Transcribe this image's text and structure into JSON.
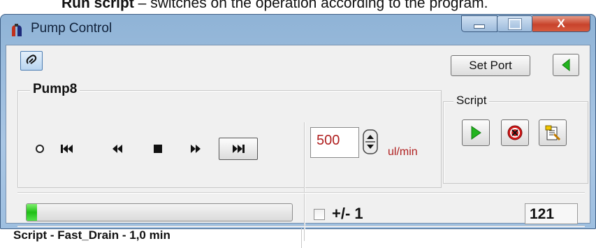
{
  "doc_text": {
    "bold": "Run script",
    "rest": " – switches on the operation according to the program."
  },
  "window": {
    "title": "Pump Control",
    "close_glyph": "X"
  },
  "toolbar": {
    "set_port_label": "Set Port"
  },
  "pump": {
    "name": "Pump8",
    "rate_value": "500",
    "rate_unit": "ul/min"
  },
  "script_group": {
    "label": "Script"
  },
  "status": {
    "progress_fraction": 0.04,
    "tolerance_label": "+/- 1",
    "tolerance_checked": false,
    "count_value": "121",
    "script_status": "Script - Fast_Drain  - 1,0 min"
  },
  "colors": {
    "rate_text": "#b02020",
    "progress_fill": "#1fbf16",
    "play_green": "#22b41e",
    "stop_red": "#d01818"
  }
}
